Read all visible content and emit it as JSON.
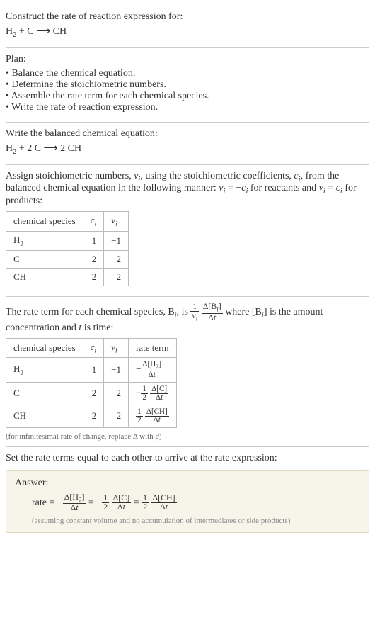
{
  "prompt": {
    "line1": "Construct the rate of reaction expression for:",
    "equation_html": "H<sub>2</sub> + C ⟶ CH"
  },
  "plan": {
    "heading": "Plan:",
    "items": [
      "Balance the chemical equation.",
      "Determine the stoichiometric numbers.",
      "Assemble the rate term for each chemical species.",
      "Write the rate of reaction expression."
    ]
  },
  "balanced": {
    "heading": "Write the balanced chemical equation:",
    "equation_html": "H<sub>2</sub> + 2 C ⟶ 2 CH"
  },
  "stoich": {
    "text_html": "Assign stoichiometric numbers, <span class='italic'>ν<sub>i</sub></span>, using the stoichiometric coefficients, <span class='italic'>c<sub>i</sub></span>, from the balanced chemical equation in the following manner: <span class='italic'>ν<sub>i</sub></span> = −<span class='italic'>c<sub>i</sub></span> for reactants and <span class='italic'>ν<sub>i</sub></span> = <span class='italic'>c<sub>i</sub></span> for products:",
    "headers": {
      "species": "chemical species",
      "ci_html": "<span class='italic'>c<sub>i</sub></span>",
      "vi_html": "<span class='italic'>ν<sub>i</sub></span>"
    },
    "rows": [
      {
        "species_html": "H<sub>2</sub>",
        "ci": "1",
        "vi": "−1"
      },
      {
        "species_html": "C",
        "ci": "2",
        "vi": "−2"
      },
      {
        "species_html": "CH",
        "ci": "2",
        "vi": "2"
      }
    ]
  },
  "rateterm": {
    "text_html": "The rate term for each chemical species, B<sub><span class='italic'>i</span></sub>, is <span class='frac'><span class='num'>1</span><span class='den'><span class='italic'>ν<sub>i</sub></span></span></span> <span class='frac'><span class='num'>Δ[B<sub><span class='italic'>i</span></sub>]</span><span class='den'>Δ<span class='italic'>t</span></span></span> where [B<sub><span class='italic'>i</span></sub>] is the amount concentration and <span class='italic'>t</span> is time:",
    "headers": {
      "species": "chemical species",
      "ci_html": "<span class='italic'>c<sub>i</sub></span>",
      "vi_html": "<span class='italic'>ν<sub>i</sub></span>",
      "rate": "rate term"
    },
    "rows": [
      {
        "species_html": "H<sub>2</sub>",
        "ci": "1",
        "vi": "−1",
        "rate_html": "−<span class='frac'><span class='num'>Δ[H<sub>2</sub>]</span><span class='den'>Δ<span class='italic'>t</span></span></span>"
      },
      {
        "species_html": "C",
        "ci": "2",
        "vi": "−2",
        "rate_html": "−<span class='frac'><span class='num'>1</span><span class='den'>2</span></span> <span class='frac'><span class='num'>Δ[C]</span><span class='den'>Δ<span class='italic'>t</span></span></span>"
      },
      {
        "species_html": "CH",
        "ci": "2",
        "vi": "2",
        "rate_html": "<span class='frac'><span class='num'>1</span><span class='den'>2</span></span> <span class='frac'><span class='num'>Δ[CH]</span><span class='den'>Δ<span class='italic'>t</span></span></span>"
      }
    ],
    "note_html": "(for infinitesimal rate of change, replace Δ with <span class='italic'>d</span>)"
  },
  "final": {
    "heading": "Set the rate terms equal to each other to arrive at the rate expression:",
    "answer_label": "Answer:",
    "rate_html": "rate = −<span class='frac'><span class='num'>Δ[H<sub>2</sub>]</span><span class='den'>Δ<span class='italic'>t</span></span></span> = −<span class='frac'><span class='num'>1</span><span class='den'>2</span></span> <span class='frac'><span class='num'>Δ[C]</span><span class='den'>Δ<span class='italic'>t</span></span></span> = <span class='frac'><span class='num'>1</span><span class='den'>2</span></span> <span class='frac'><span class='num'>Δ[CH]</span><span class='den'>Δ<span class='italic'>t</span></span></span>",
    "assumption": "(assuming constant volume and no accumulation of intermediates or side products)"
  }
}
